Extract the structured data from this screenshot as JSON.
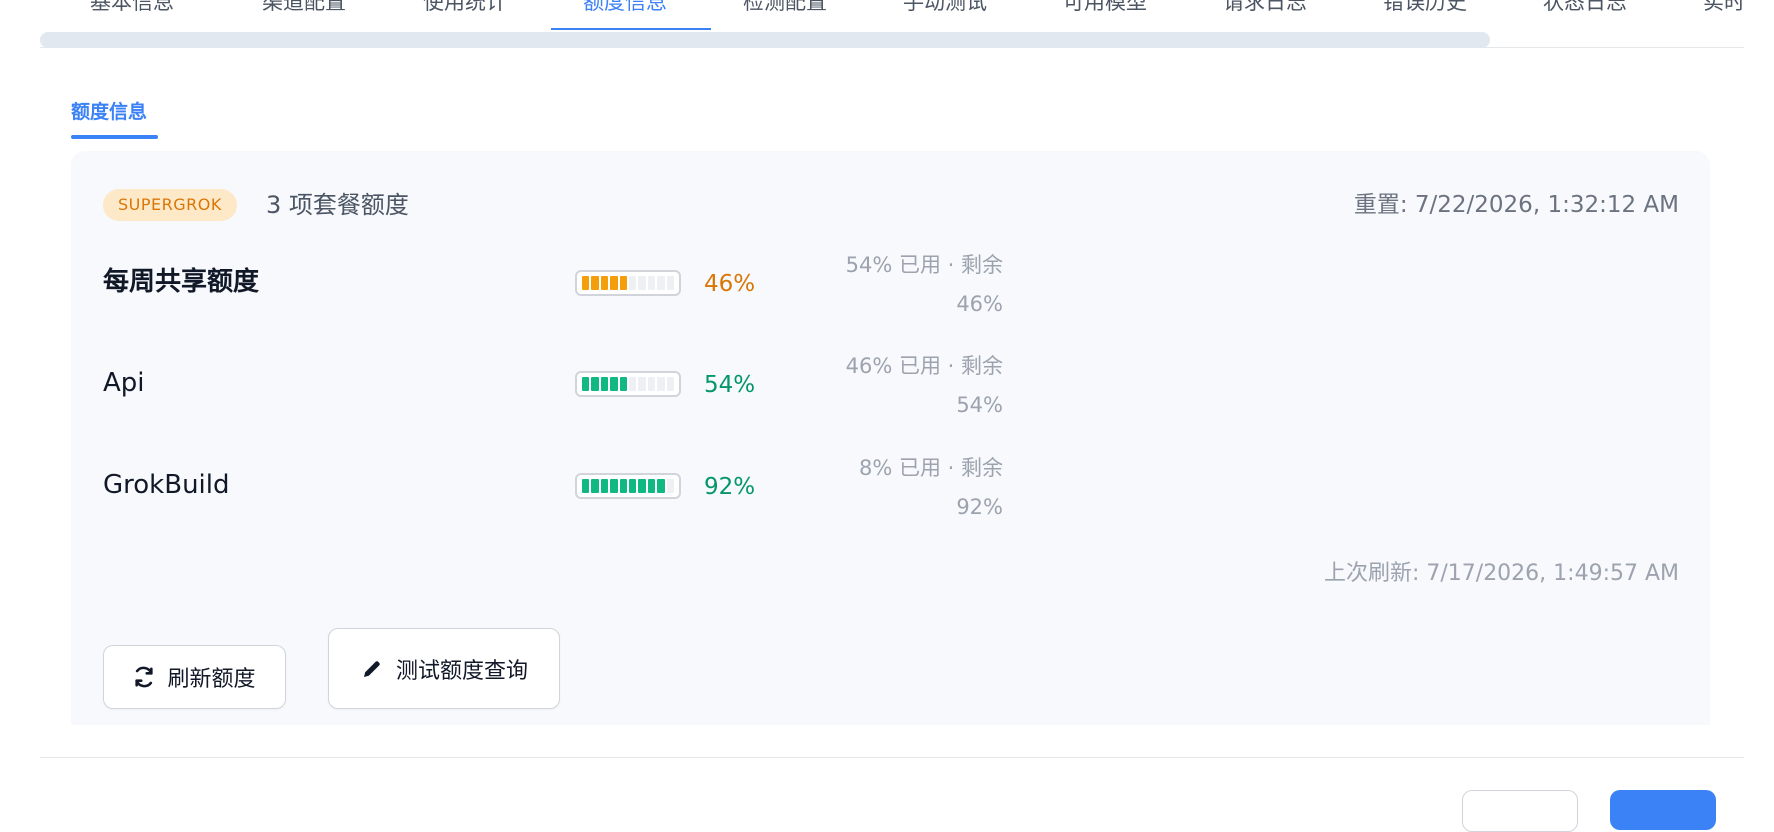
{
  "tabs": [
    {
      "label": "基本信息"
    },
    {
      "label": "渠道配置"
    },
    {
      "label": "使用统计"
    },
    {
      "label": "额度信息",
      "active": true
    },
    {
      "label": "检测配置"
    },
    {
      "label": "手动测试"
    },
    {
      "label": "可用模型"
    },
    {
      "label": "请求日志"
    },
    {
      "label": "错误历史"
    },
    {
      "label": "状态日志"
    },
    {
      "label": "实时"
    }
  ],
  "subtab": {
    "label": "额度信息"
  },
  "quota": {
    "badge": "SUPERGROK",
    "summary": "3 项套餐额度",
    "reset": "重置: 7/22/2026, 1:32:12 AM",
    "last_refresh": "上次刷新: 7/17/2026, 1:49:57 AM",
    "items": [
      {
        "name": "每周共享额度",
        "percent_text": "46%",
        "remaining": 0.46,
        "color": "#d97706",
        "fill_color": "#f59e0b",
        "detail_line1": "54% 已用 · 剩余",
        "detail_line2": "46%"
      },
      {
        "name": "Api",
        "percent_text": "54%",
        "remaining": 0.54,
        "color": "#059669",
        "fill_color": "#10b981",
        "detail_line1": "46% 已用 · 剩余",
        "detail_line2": "54%"
      },
      {
        "name": "GrokBuild",
        "percent_text": "92%",
        "remaining": 0.92,
        "color": "#059669",
        "fill_color": "#10b981",
        "detail_line1": "8% 已用 · 剩余",
        "detail_line2": "92%"
      }
    ]
  },
  "actions": {
    "refresh_label": "刷新额度",
    "test_label": "测试额度查询"
  },
  "icons": {
    "refresh": "refresh-icon",
    "test": "pen-icon"
  },
  "colors": {
    "accent": "#3b82f6",
    "badge_bg": "#fde8c7",
    "badge_text": "#d97706"
  }
}
